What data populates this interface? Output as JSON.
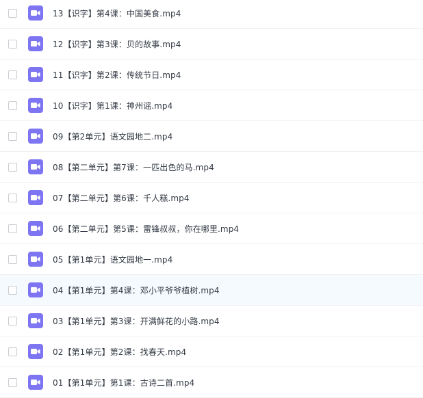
{
  "icon_color": "#7e75f2",
  "files": [
    {
      "name": "13【识字】第4课：中国美食.mp4",
      "icon": "video-file-icon",
      "checked": false
    },
    {
      "name": "12【识字】第3课：贝的故事.mp4",
      "icon": "video-file-icon",
      "checked": false
    },
    {
      "name": "11【识字】第2课：传统节日.mp4",
      "icon": "video-file-icon",
      "checked": false
    },
    {
      "name": "10【识字】第1课：神州谣.mp4",
      "icon": "video-file-icon",
      "checked": false
    },
    {
      "name": "09【第2单元】语文园地二.mp4",
      "icon": "video-file-icon",
      "checked": false
    },
    {
      "name": "08【第二单元】第7课：一匹出色的马.mp4",
      "icon": "video-file-icon",
      "checked": false
    },
    {
      "name": "07【第二单元】第6课：千人糕.mp4",
      "icon": "video-file-icon",
      "checked": false
    },
    {
      "name": "06【第二单元】第5课：雷锋叔叔，你在哪里.mp4",
      "icon": "video-file-icon",
      "checked": false
    },
    {
      "name": "05【第1单元】语文园地一.mp4",
      "icon": "video-file-icon",
      "checked": false
    },
    {
      "name": "04【第1单元】第4课：邓小平爷爷植树.mp4",
      "icon": "video-file-icon",
      "checked": false,
      "hovered": true
    },
    {
      "name": "03【第1单元】第3课：开满鲜花的小路.mp4",
      "icon": "video-file-icon",
      "checked": false
    },
    {
      "name": "02【第1单元】第2课：找春天.mp4",
      "icon": "video-file-icon",
      "checked": false
    },
    {
      "name": "01【第1单元】第1课：古诗二首.mp4",
      "icon": "video-file-icon",
      "checked": false
    }
  ]
}
